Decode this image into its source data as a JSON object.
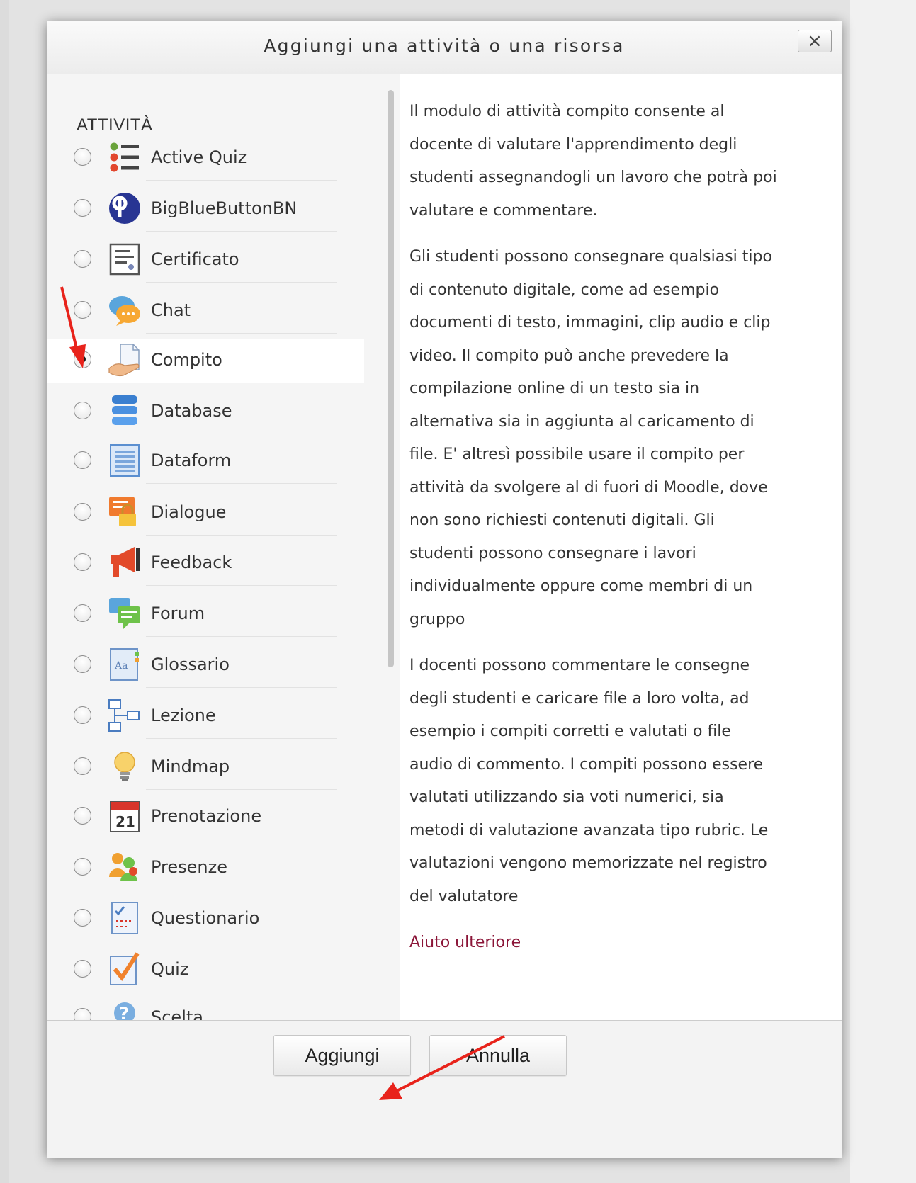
{
  "dialog": {
    "title": "Aggiungi una attività o una risorsa",
    "close_label": "×",
    "section_label": "ATTIVITÀ",
    "options": [
      {
        "label": "Active Quiz",
        "icon": "active-quiz-icon",
        "selected": false
      },
      {
        "label": "BigBlueButtonBN",
        "icon": "bigbluebutton-icon",
        "selected": false
      },
      {
        "label": "Certificato",
        "icon": "certificate-icon",
        "selected": false
      },
      {
        "label": "Chat",
        "icon": "chat-icon",
        "selected": false
      },
      {
        "label": "Compito",
        "icon": "assignment-icon",
        "selected": true
      },
      {
        "label": "Database",
        "icon": "database-icon",
        "selected": false
      },
      {
        "label": "Dataform",
        "icon": "dataform-icon",
        "selected": false
      },
      {
        "label": "Dialogue",
        "icon": "dialogue-icon",
        "selected": false
      },
      {
        "label": "Feedback",
        "icon": "feedback-icon",
        "selected": false
      },
      {
        "label": "Forum",
        "icon": "forum-icon",
        "selected": false
      },
      {
        "label": "Glossario",
        "icon": "glossary-icon",
        "selected": false
      },
      {
        "label": "Lezione",
        "icon": "lesson-icon",
        "selected": false
      },
      {
        "label": "Mindmap",
        "icon": "mindmap-icon",
        "selected": false
      },
      {
        "label": "Prenotazione",
        "icon": "calendar-icon",
        "selected": false
      },
      {
        "label": "Presenze",
        "icon": "attendance-icon",
        "selected": false
      },
      {
        "label": "Questionario",
        "icon": "questionnaire-icon",
        "selected": false
      },
      {
        "label": "Quiz",
        "icon": "quiz-icon",
        "selected": false
      },
      {
        "label": "Scelta",
        "icon": "choice-icon",
        "selected": false
      }
    ],
    "description": {
      "paragraphs": [
        "Il modulo di attività compito consente al docente di valutare l'apprendimento degli studenti assegnandogli un lavoro che potrà poi valutare e commentare.",
        "Gli studenti possono consegnare qualsiasi tipo di contenuto digitale, come ad esempio documenti di testo, immagini, clip audio e clip video. Il compito può anche prevedere la compilazione online di un testo sia in alternativa sia in aggiunta al caricamento di file. E' altresì possibile usare il compito per attività da svolgere al di fuori di Moodle, dove non sono richiesti contenuti digitali. Gli studenti possono consegnare i lavori individualmente oppure come membri di un gruppo",
        "I docenti possono commentare le consegne degli studenti e caricare file a loro volta, ad esempio i compiti corretti e valutati o file audio di commento. I compiti possono essere valutati utilizzando sia voti numerici, sia metodi di valutazione avanzata tipo rubric. Le valutazioni vengono memorizzate nel registro del valutatore"
      ],
      "help_link": "Aiuto ulteriore"
    },
    "footer": {
      "add_label": "Aggiungi",
      "cancel_label": "Annulla"
    }
  },
  "colors": {
    "help_link": "#8b1538",
    "annotation_arrow": "#e8231b"
  }
}
